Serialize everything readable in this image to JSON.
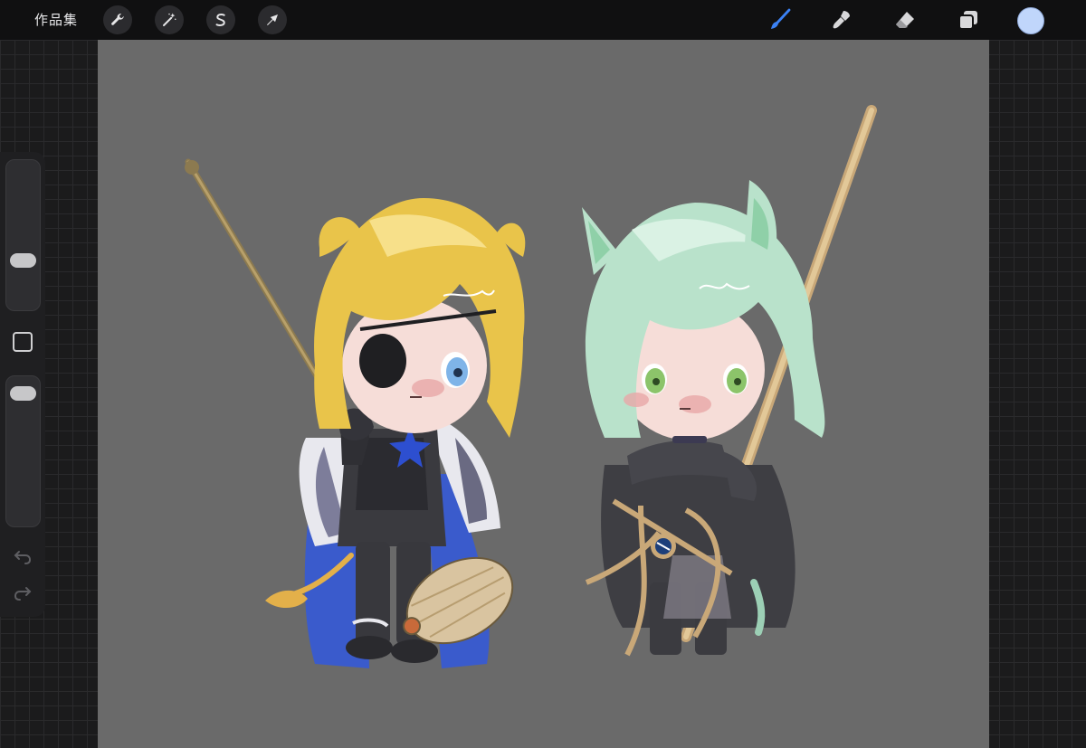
{
  "topbar": {
    "gallery_label": "作品集",
    "left_tools": [
      {
        "name": "actions",
        "icon": "wrench-icon"
      },
      {
        "name": "adjustments",
        "icon": "magic-wand-icon"
      },
      {
        "name": "selection",
        "icon": "selection-s-icon"
      },
      {
        "name": "transform",
        "icon": "arrow-icon"
      }
    ],
    "right_tools": [
      {
        "name": "brush",
        "icon": "brush-icon",
        "active": true
      },
      {
        "name": "smudge",
        "icon": "smudge-icon",
        "active": false
      },
      {
        "name": "eraser",
        "icon": "eraser-icon",
        "active": false
      },
      {
        "name": "layers",
        "icon": "layers-icon",
        "active": false
      }
    ],
    "current_color": "#c0d6fb"
  },
  "sidebar": {
    "brush_size_level": 0.3,
    "opacity_level": 0.05,
    "undo_icon": "undo-icon",
    "redo_icon": "redo-icon"
  },
  "colors": {
    "canvas_bg": "#6a6a6a",
    "active_tool": "#3b82f6",
    "hair_blonde": "#e9c44a",
    "hair_mint": "#b9e2cb",
    "armor": "#3a3a3f",
    "cape_blue": "#3a5bcc"
  }
}
